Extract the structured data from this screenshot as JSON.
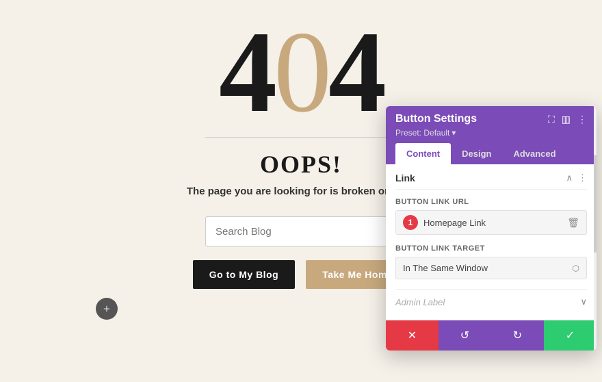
{
  "page": {
    "background_color": "#f5f0e8",
    "error_code": {
      "left": "4",
      "middle": "0",
      "right": "4"
    },
    "oops_title": "OOPS!",
    "description": "The page you are looking for is broken or does",
    "search_placeholder": "Search Blog",
    "btn_blog_label": "Go to My Blog",
    "btn_home_label": "Take Me Home"
  },
  "panel": {
    "title": "Button Settings",
    "preset_label": "Preset: Default",
    "tabs": [
      {
        "id": "content",
        "label": "Content",
        "active": true
      },
      {
        "id": "design",
        "label": "Design",
        "active": false
      },
      {
        "id": "advanced",
        "label": "Advanced",
        "active": false
      }
    ],
    "section_title": "Link",
    "button_link_url_label": "Button Link URL",
    "badge_number": "1",
    "homepage_link_value": "Homepage Link",
    "button_link_target_label": "Button Link Target",
    "link_target_value": "In The Same Window",
    "admin_label": "Admin Label",
    "footer_buttons": {
      "cancel_icon": "✕",
      "reset_icon": "↺",
      "redo_icon": "↻",
      "save_icon": "✓"
    }
  }
}
